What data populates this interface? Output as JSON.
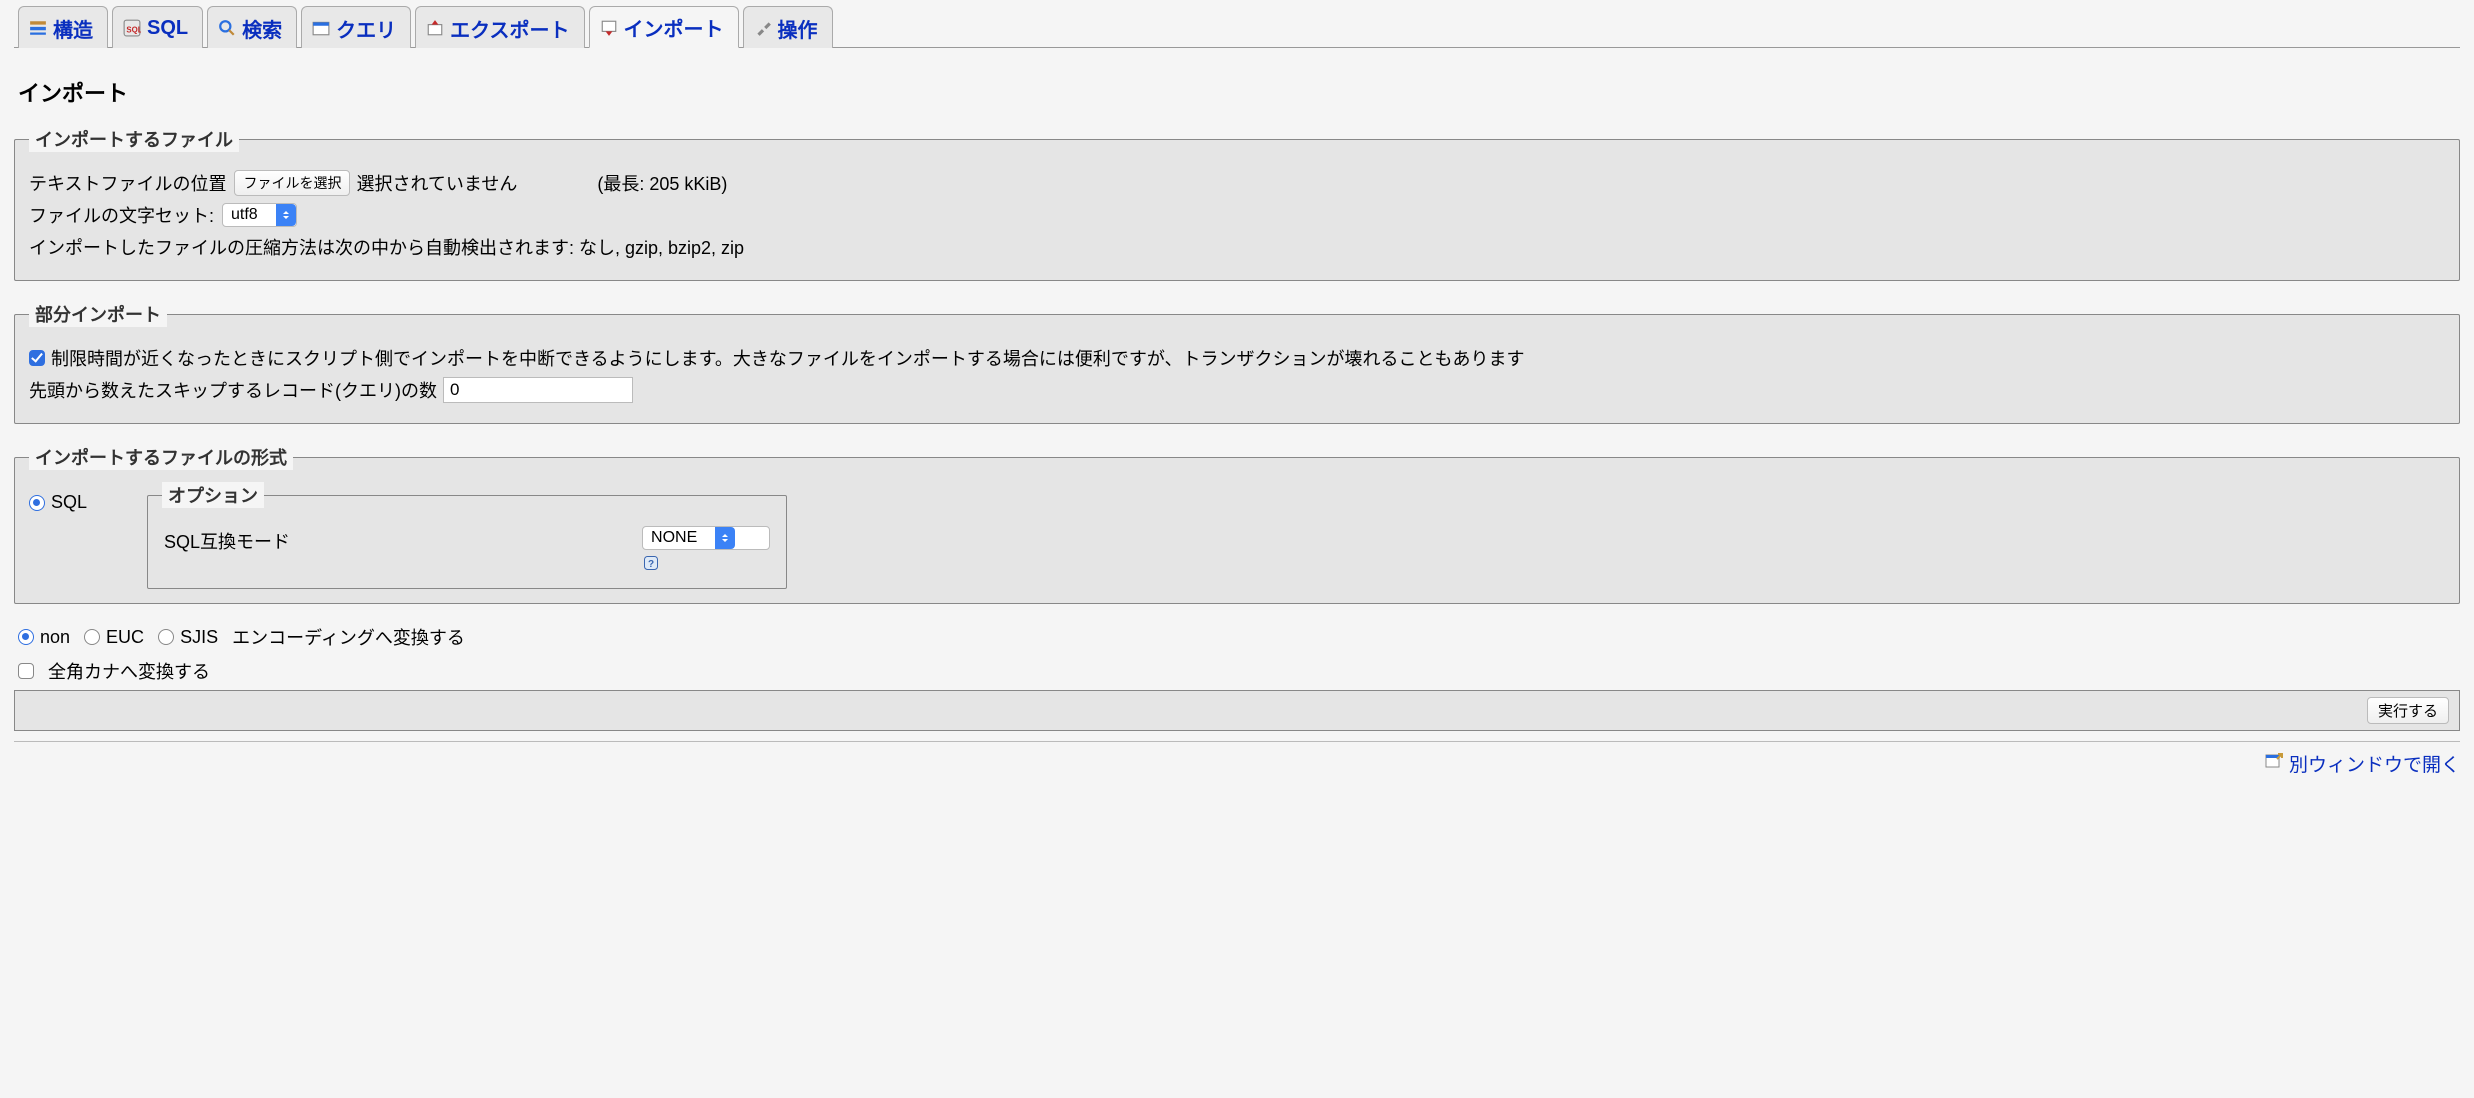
{
  "tabs": {
    "structure": "構造",
    "sql": "SQL",
    "search": "検索",
    "query": "クエリ",
    "export": "エクスポート",
    "import": "インポート",
    "operations": "操作"
  },
  "page_title": "インポート",
  "fieldset_file": {
    "legend": "インポートするファイル",
    "location_label": "テキストファイルの位置",
    "choose_btn": "ファイルを選択",
    "choose_status": "選択されていません",
    "max_size": "(最長: 205 kKiB)",
    "charset_label": "ファイルの文字セット:",
    "charset_value": "utf8",
    "compression_note": "インポートしたファイルの圧縮方法は次の中から自動検出されます: なし, gzip, bzip2, zip"
  },
  "fieldset_partial": {
    "legend": "部分インポート",
    "allow_interrupt_label": "制限時間が近くなったときにスクリプト側でインポートを中断できるようにします。大きなファイルをインポートする場合には便利ですが、トランザクションが壊れることもあります",
    "skip_label": "先頭から数えたスキップするレコード(クエリ)の数",
    "skip_value": "0"
  },
  "fieldset_format": {
    "legend": "インポートするファイルの形式",
    "format_sql": "SQL",
    "options_legend": "オプション",
    "compat_label": "SQL互換モード",
    "compat_value": "NONE"
  },
  "encoding": {
    "non": "non",
    "euc": "EUC",
    "sjis": "SJIS",
    "convert_label": "エンコーディングへ変換する"
  },
  "kana": {
    "label": "全角カナへ変換する"
  },
  "submit_label": "実行する",
  "footer": {
    "open_new_window": "別ウィンドウで開く"
  }
}
